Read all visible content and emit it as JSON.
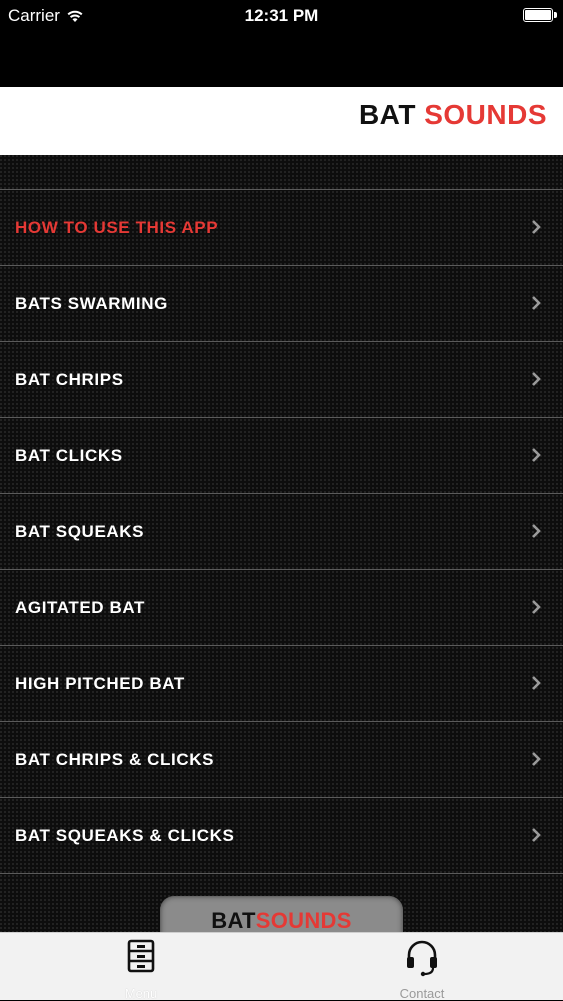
{
  "status_bar": {
    "carrier": "Carrier",
    "time": "12:31 PM",
    "battery_level": 1.0
  },
  "header": {
    "title_part1": "BAT",
    "title_part2": "SOUNDS"
  },
  "menu": {
    "items": [
      {
        "label": "HOW TO USE THIS APP",
        "active": true
      },
      {
        "label": "BATS SWARMING"
      },
      {
        "label": "BAT CHRIPS"
      },
      {
        "label": "BAT CLICKS"
      },
      {
        "label": "BAT SQUEAKS"
      },
      {
        "label": "AGITATED BAT"
      },
      {
        "label": "HIGH PITCHED BAT"
      },
      {
        "label": "BAT CHRIPS & CLICKS"
      },
      {
        "label": "BAT SQUEAKS & CLICKS"
      }
    ]
  },
  "badge": {
    "part1": "BAT",
    "part2": "SOUNDS"
  },
  "tabbar": {
    "tabs": [
      {
        "label": "Menu",
        "icon": "filing-cabinet-icon",
        "selected": true
      },
      {
        "label": "Contact",
        "icon": "headset-icon",
        "selected": false
      }
    ]
  },
  "colors": {
    "accent": "#e53935",
    "background": "#0d0d0d",
    "separator": "#5a5a5a"
  }
}
